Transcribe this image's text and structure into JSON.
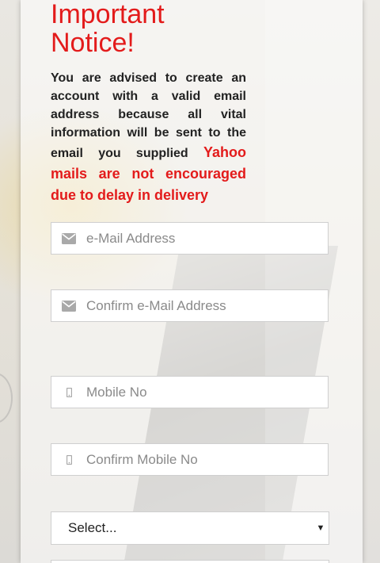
{
  "notice": {
    "title_line1": "Important",
    "title_line2": "Notice!",
    "body": "You are advised to create an account with a valid email address because all vital information will be sent to the email you supplied ",
    "warning": "Yahoo mails are not encouraged due to delay in delivery"
  },
  "form": {
    "email": {
      "placeholder": "e-Mail Address",
      "icon": "envelope-icon"
    },
    "confirm_email": {
      "placeholder": "Confirm e-Mail Address",
      "icon": "envelope-icon"
    },
    "mobile": {
      "placeholder": "Mobile No",
      "icon": "mobile-phone-icon"
    },
    "confirm_mobile": {
      "placeholder": "Confirm Mobile No",
      "icon": "mobile-phone-icon"
    },
    "select": {
      "value": "Select..."
    }
  },
  "colors": {
    "accent_red": "#e31b1b",
    "text_dark": "#222222",
    "placeholder_gray": "#8a8a8a"
  }
}
